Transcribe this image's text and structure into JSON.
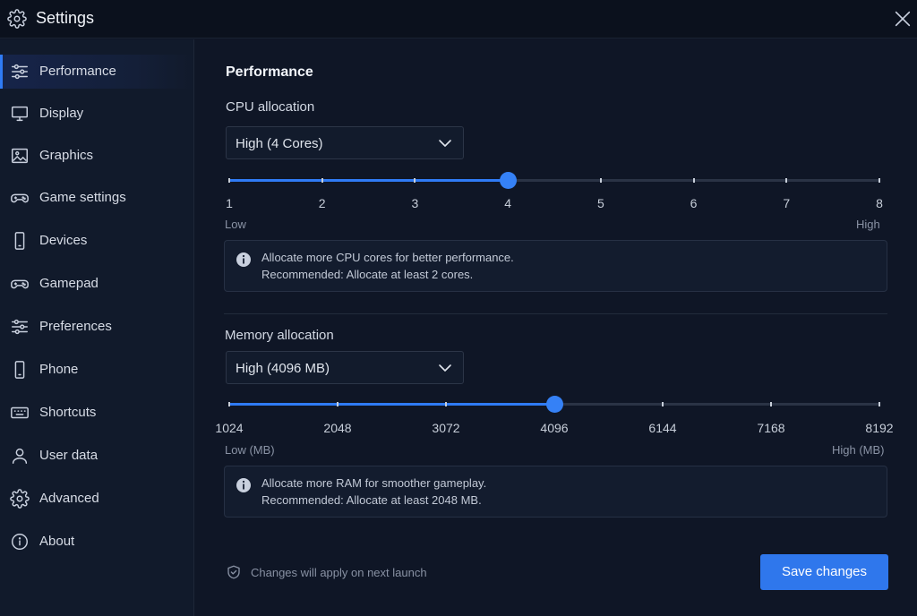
{
  "window": {
    "title": "Settings"
  },
  "sidebar": {
    "items": [
      {
        "label": "Performance",
        "icon": "sliders-icon",
        "active": true
      },
      {
        "label": "Display",
        "icon": "monitor-icon"
      },
      {
        "label": "Graphics",
        "icon": "image-icon"
      },
      {
        "label": "Game settings",
        "icon": "gamepad-icon"
      },
      {
        "label": "Devices",
        "icon": "phone-icon"
      },
      {
        "label": "Gamepad",
        "icon": "controller-icon"
      },
      {
        "label": "Preferences",
        "icon": "sliders-icon"
      },
      {
        "label": "Phone",
        "icon": "phone-icon"
      },
      {
        "label": "Shortcuts",
        "icon": "keyboard-icon"
      },
      {
        "label": "User data",
        "icon": "user-icon"
      },
      {
        "label": "Advanced",
        "icon": "gear-icon"
      },
      {
        "label": "About",
        "icon": "info-icon"
      }
    ]
  },
  "main": {
    "title": "Performance",
    "cpu": {
      "label": "CPU allocation",
      "selected": "High (4 Cores)",
      "ticks": [
        "1",
        "2",
        "3",
        "4",
        "5",
        "6",
        "7",
        "8"
      ],
      "value_index": 3,
      "low_label": "Low",
      "high_label": "High",
      "info_line1": "Allocate more CPU cores for better performance.",
      "info_line2": "Recommended: Allocate at least 2 cores."
    },
    "memory": {
      "label": "Memory allocation",
      "selected": "High (4096 MB)",
      "ticks": [
        "1024",
        "2048",
        "3072",
        "4096",
        "6144",
        "7168",
        "8192"
      ],
      "value_index": 3,
      "low_label": "Low (MB)",
      "high_label": "High (MB)",
      "info_line1": "Allocate more RAM for smoother gameplay.",
      "info_line2": "Recommended: Allocate at least 2048 MB."
    },
    "footer_note": "Changes will apply on next launch",
    "save_label": "Save changes"
  },
  "colors": {
    "accent": "#2f7bf5",
    "background": "#0f1626",
    "sidebar": "#111a2b"
  }
}
